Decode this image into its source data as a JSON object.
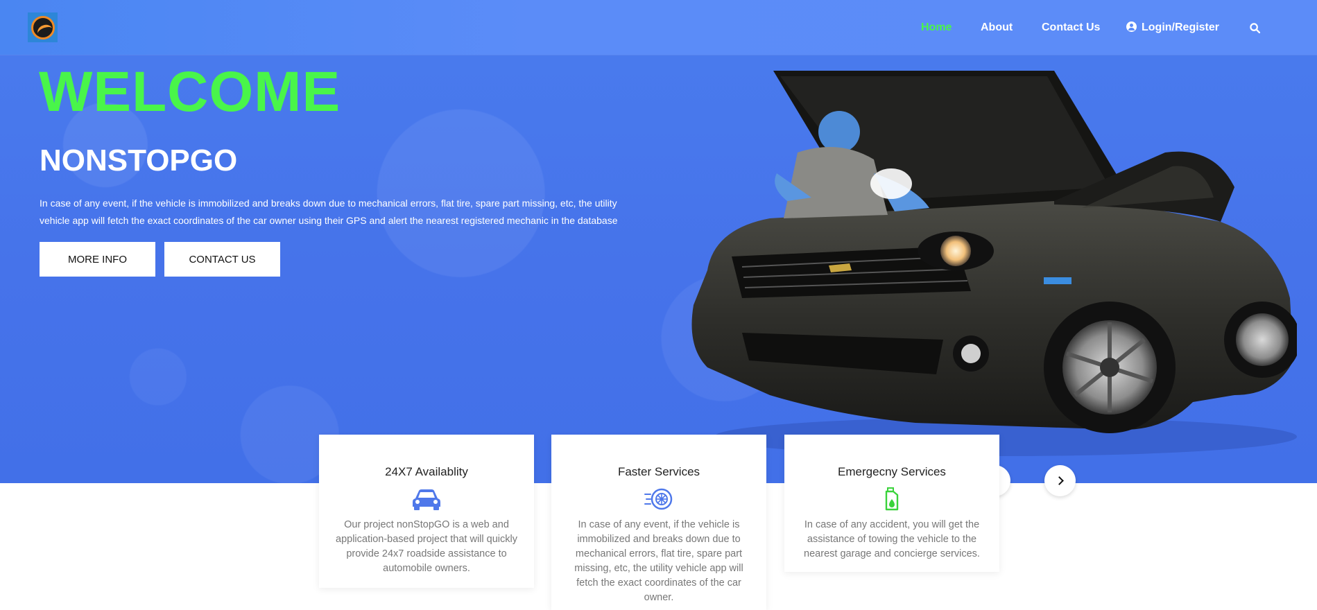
{
  "nav": {
    "items": [
      {
        "label": "Home",
        "active": true
      },
      {
        "label": "About",
        "active": false
      },
      {
        "label": "Contact Us",
        "active": false
      },
      {
        "label": "Login/Register",
        "active": false
      }
    ],
    "search_icon": "search-icon",
    "login_icon": "user-circle-icon"
  },
  "hero": {
    "welcome": "WELCOME",
    "brand": "NONSTOPGO",
    "lead": "In case of any event, if the vehicle is immobilized and breaks down due to mechanical errors, flat tire, spare part missing, etc, the utility vehicle app will fetch the exact coordinates of the car owner using their GPS and alert the nearest registered mechanic in the database",
    "more_info_label": "MORE INFO",
    "contact_label": "CONTACT US"
  },
  "services": [
    {
      "title": "24X7 Availablity",
      "icon": "car-icon",
      "text": "Our project nonStopGO is a web and application-based project that will quickly provide 24x7 roadside assistance to automobile owners."
    },
    {
      "title": "Faster Services",
      "icon": "tyre-speed-icon",
      "text": "In case of any event, if the vehicle is immobilized and breaks down due to mechanical errors, flat tire, spare part missing, etc, the utility vehicle app will fetch the exact coordinates of the car owner."
    },
    {
      "title": "Emergecny Services",
      "icon": "fuel-can-icon",
      "text": "In case of any accident, you will get the assistance of towing the vehicle to the nearest garage and concierge services."
    }
  ],
  "colors": {
    "accent_green": "#49f54a",
    "hero_blue": "#4673ea",
    "nav_blue": "#5b8cf8",
    "icon_blue": "#4f78ea"
  }
}
